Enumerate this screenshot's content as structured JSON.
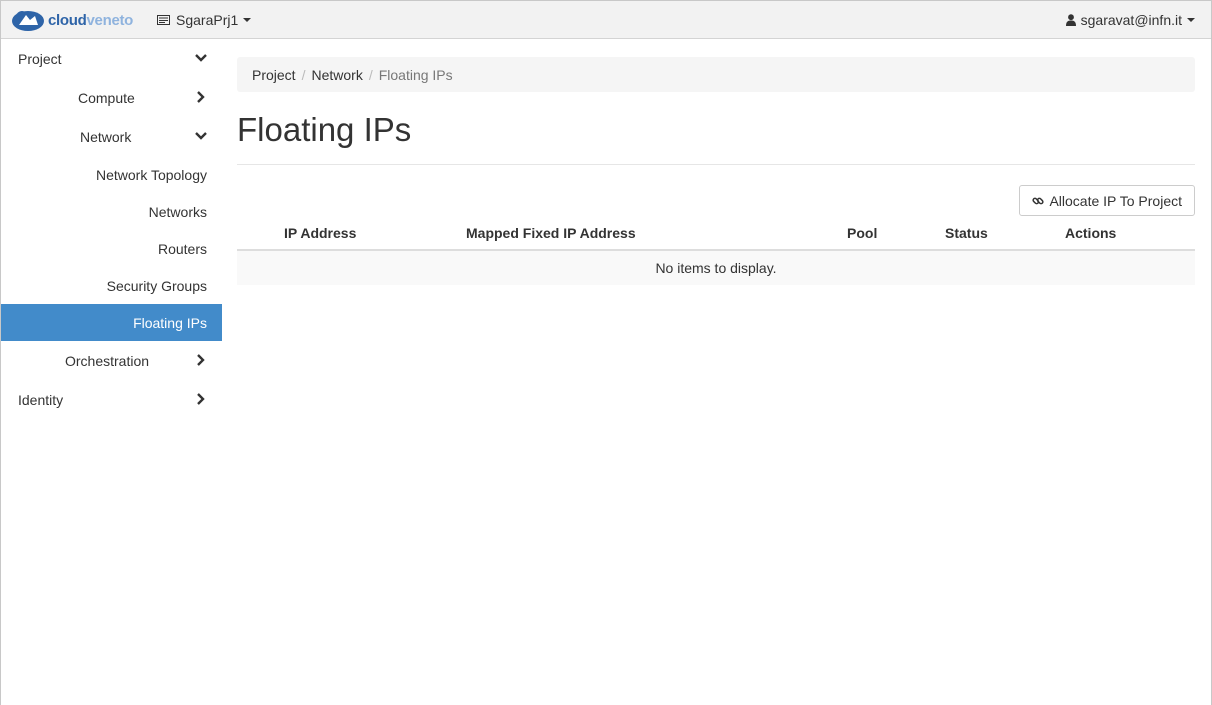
{
  "navbar": {
    "brand": {
      "part1": "cloud",
      "part2": "veneto"
    },
    "project_switcher": {
      "label": "SgaraPrj1",
      "icon": "id-card-icon"
    },
    "user_menu": {
      "label": "sgaravat@infn.it",
      "icon": "user-icon"
    }
  },
  "sidebar": {
    "project": "Project",
    "compute": "Compute",
    "network": "Network",
    "network_items": {
      "topology": "Network Topology",
      "networks": "Networks",
      "routers": "Routers",
      "security_groups": "Security Groups",
      "floating_ips": "Floating IPs"
    },
    "orchestration": "Orchestration",
    "identity": "Identity"
  },
  "breadcrumb": {
    "project": "Project",
    "network": "Network",
    "current": "Floating IPs",
    "separator": "/"
  },
  "page": {
    "title": "Floating IPs"
  },
  "toolbar": {
    "allocate_label": "Allocate IP To Project"
  },
  "table": {
    "columns": {
      "ip_address": "IP Address",
      "mapped_fixed_ip": "Mapped Fixed IP Address",
      "pool": "Pool",
      "status": "Status",
      "actions": "Actions"
    },
    "empty_message": "No items to display."
  },
  "colors": {
    "accent": "#428bca",
    "brand_dark": "#2e64a8",
    "brand_light": "#8fb3de"
  }
}
